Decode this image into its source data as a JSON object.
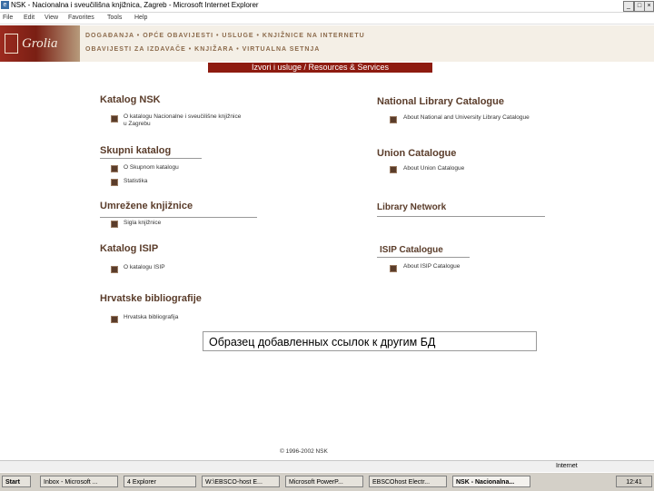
{
  "window": {
    "title": "NSK - Nacionalna i sveučilišna knjižnica, Zagreb - Microsoft Internet Explorer",
    "minimize": "_",
    "maximize": "□",
    "close": "×"
  },
  "menu": [
    "File",
    "Edit",
    "View",
    "Favorites",
    "Tools",
    "Help"
  ],
  "header": {
    "logo_text": "Grolia",
    "nav_line1": "DOGAĐANJA • OPĆE OBAVIJESTI • USLUGE • KNJIŽNICE NA INTERNETU",
    "nav_line2": "OBAVIJESTI ZA IZDAVAČE • KNJIŽARA • VIRTUALNA SETNJA",
    "banner": "Izvori i usluge / Resources & Services"
  },
  "left": {
    "katalog_nsk": "Katalog NSK",
    "katalog_nsk_item": "O katalogu Nacionalne i sveučilišne knjižnice u Zagrebu",
    "skupni": "Skupni katalog",
    "skupni_item1": "O Skupnom katalogu",
    "skupni_item2": "Statistika",
    "umrezene": "Umrežene knjižnice",
    "umrezene_item": "Sigla knjižnice",
    "isip": "Katalog ISIP",
    "isip_item": "O katalogu ISIP",
    "biblio": "Hrvatske bibliografije",
    "biblio_item": "Hrvatska bibliografija"
  },
  "right": {
    "nlc": "National Library Catalogue",
    "nlc_item": "About National and University Library Catalogue",
    "union": "Union Catalogue",
    "union_item": "About Union Catalogue",
    "network": "Library Network",
    "isip": "ISIP Catalogue",
    "isip_item": "About ISIP Catalogue"
  },
  "overlay_text": "Образец добавленных ссылок к другим БД",
  "copyright": "© 1996-2002 NSK",
  "status": {
    "zone": "Internet"
  },
  "taskbar": {
    "start": "Start",
    "tasks": [
      "Inbox - Microsoft ...",
      "4 Explorer",
      "W:\\EBSCO-host E...",
      "Microsoft PowerP...",
      "EBSCOhost Electr...",
      "NSK - Nacionalna..."
    ],
    "clock": "12:41"
  }
}
